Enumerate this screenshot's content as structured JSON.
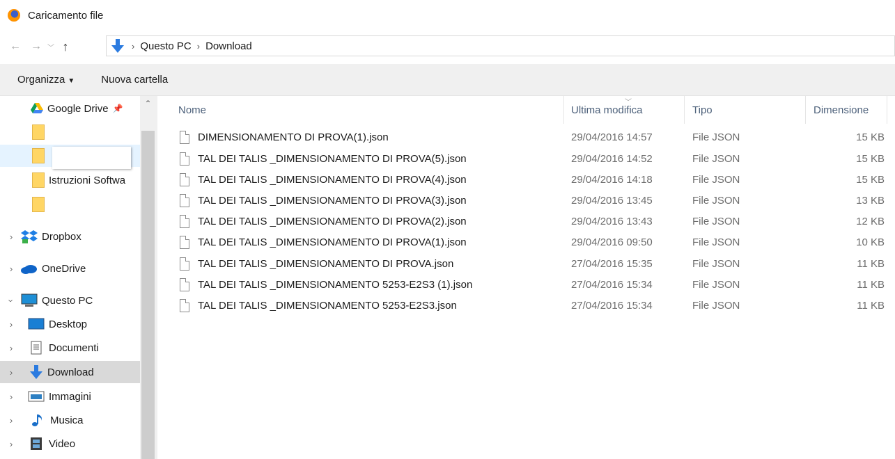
{
  "window": {
    "title": "Caricamento file"
  },
  "address": {
    "crumbs": [
      "Questo PC",
      "Download"
    ]
  },
  "toolbar": {
    "organize_label": "Organizza",
    "new_folder_label": "Nuova cartella"
  },
  "sidebar": {
    "items": [
      {
        "label": "Google Drive",
        "icon": "google-drive-icon"
      },
      {
        "label": "",
        "icon": "folder-icon"
      },
      {
        "label": "",
        "icon": "folder-icon"
      },
      {
        "label": "Istruzioni Softwa",
        "icon": "folder-icon"
      },
      {
        "label": "",
        "icon": "folder-icon"
      },
      {
        "label": "Dropbox",
        "icon": "dropbox-icon"
      },
      {
        "label": "OneDrive",
        "icon": "onedrive-icon"
      },
      {
        "label": "Questo PC",
        "icon": "computer-icon"
      },
      {
        "label": "Desktop",
        "icon": "desktop-icon"
      },
      {
        "label": "Documenti",
        "icon": "documents-icon"
      },
      {
        "label": "Download",
        "icon": "download-icon"
      },
      {
        "label": "Immagini",
        "icon": "pictures-icon"
      },
      {
        "label": "Musica",
        "icon": "music-icon"
      },
      {
        "label": "Video",
        "icon": "video-icon"
      }
    ]
  },
  "columns": {
    "name": "Nome",
    "modified": "Ultima modifica",
    "type": "Tipo",
    "size": "Dimensione"
  },
  "files": [
    {
      "name": "DIMENSIONAMENTO DI PROVA(1).json",
      "modified": "29/04/2016 14:57",
      "type": "File JSON",
      "size": "15 KB"
    },
    {
      "name": "TAL DEI TALIS _DIMENSIONAMENTO DI PROVA(5).json",
      "modified": "29/04/2016 14:52",
      "type": "File JSON",
      "size": "15 KB"
    },
    {
      "name": "TAL DEI TALIS _DIMENSIONAMENTO DI PROVA(4).json",
      "modified": "29/04/2016 14:18",
      "type": "File JSON",
      "size": "15 KB"
    },
    {
      "name": "TAL DEI TALIS _DIMENSIONAMENTO DI PROVA(3).json",
      "modified": "29/04/2016 13:45",
      "type": "File JSON",
      "size": "13 KB"
    },
    {
      "name": "TAL DEI TALIS _DIMENSIONAMENTO DI PROVA(2).json",
      "modified": "29/04/2016 13:43",
      "type": "File JSON",
      "size": "12 KB"
    },
    {
      "name": "TAL DEI TALIS _DIMENSIONAMENTO DI PROVA(1).json",
      "modified": "29/04/2016 09:50",
      "type": "File JSON",
      "size": "10 KB"
    },
    {
      "name": "TAL DEI TALIS _DIMENSIONAMENTO DI PROVA.json",
      "modified": "27/04/2016 15:35",
      "type": "File JSON",
      "size": "11 KB"
    },
    {
      "name": "TAL DEI TALIS _DIMENSIONAMENTO 5253-E2S3 (1).json",
      "modified": "27/04/2016 15:34",
      "type": "File JSON",
      "size": "11 KB"
    },
    {
      "name": "TAL DEI TALIS _DIMENSIONAMENTO 5253-E2S3.json",
      "modified": "27/04/2016 15:34",
      "type": "File JSON",
      "size": "11 KB"
    }
  ]
}
